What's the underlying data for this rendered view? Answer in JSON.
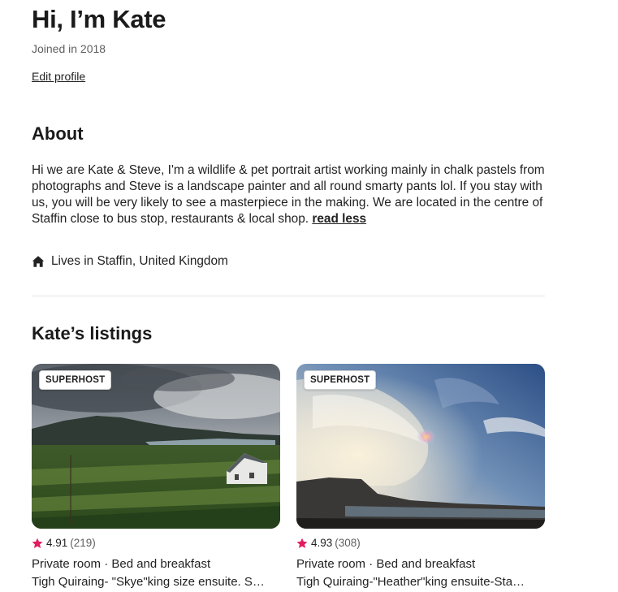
{
  "profile": {
    "title": "Hi, I’m Kate",
    "joined": "Joined in 2018",
    "edit_label": "Edit profile"
  },
  "about": {
    "heading": "About",
    "text": "Hi we are Kate & Steve, I'm a wildlife & pet portrait artist working mainly in chalk pastels from photographs and Steve is a landscape painter and all round smarty pants lol. If you stay with us, you will be very likely to see a masterpiece in the making. We are located in the centre of Staffin close to bus stop, restaurants & local shop.",
    "read_less": "read less",
    "lives_in": "Lives in Staffin, United Kingdom",
    "lives_icon": "home-icon"
  },
  "listings": {
    "heading": "Kate’s listings",
    "star_color": "#e31c5f",
    "items": [
      {
        "badge": "SUPERHOST",
        "rating": "4.91",
        "count": "(219)",
        "subtitle": "Private room · Bed and breakfast",
        "name": "Tigh Quiraing- \"Skye\"king size ensuite. S…"
      },
      {
        "badge": "SUPERHOST",
        "rating": "4.93",
        "count": "(308)",
        "subtitle": "Private room · Bed and breakfast",
        "name": "Tigh Quiraing-\"Heather\"king ensuite-Sta…"
      }
    ]
  }
}
